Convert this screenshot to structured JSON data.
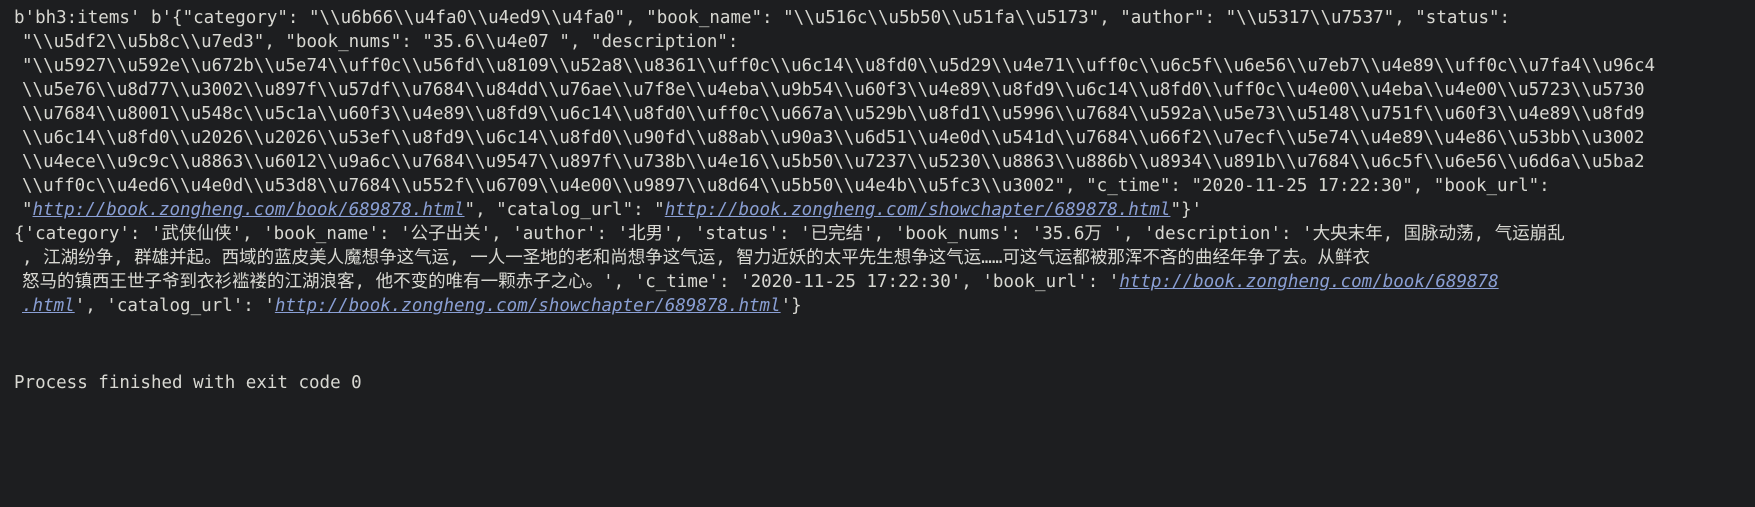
{
  "console": {
    "key_label": "b'bh3:items'",
    "bytes_prefix": "b'",
    "lines": [
      "b'bh3:items' b'{\"category\": \"\\\\u6b66\\\\u4fa0\\\\u4ed9\\\\u4fa0\", \"book_name\": \"\\\\u516c\\\\u5b50\\\\u51fa\\\\u5173\", \"author\": \"\\\\u5317\\\\u7537\", \"status\":",
      "\"\\\\u5df2\\\\u5b8c\\\\u7ed3\", \"book_nums\": \"35.6\\\\u4e07 \", \"description\":",
      "\"\\\\u5927\\\\u592e\\\\u672b\\\\u5e74\\\\uff0c\\\\u56fd\\\\u8109\\\\u52a8\\\\u8361\\\\uff0c\\\\u6c14\\\\u8fd0\\\\u5d29\\\\u4e71\\\\uff0c\\\\u6c5f\\\\u6e56\\\\u7eb7\\\\u4e89\\\\uff0c\\\\u7fa4\\\\u96c4",
      "\\\\u5e76\\\\u8d77\\\\u3002\\\\u897f\\\\u57df\\\\u7684\\\\u84dd\\\\u76ae\\\\u7f8e\\\\u4eba\\\\u9b54\\\\u60f3\\\\u4e89\\\\u8fd9\\\\u6c14\\\\u8fd0\\\\uff0c\\\\u4e00\\\\u4eba\\\\u4e00\\\\u5723\\\\u5730",
      "\\\\u7684\\\\u8001\\\\u548c\\\\u5c1a\\\\u60f3\\\\u4e89\\\\u8fd9\\\\u6c14\\\\u8fd0\\\\uff0c\\\\u667a\\\\u529b\\\\u8fd1\\\\u5996\\\\u7684\\\\u592a\\\\u5e73\\\\u5148\\\\u751f\\\\u60f3\\\\u4e89\\\\u8fd9",
      "\\\\u6c14\\\\u8fd0\\\\u2026\\\\u2026\\\\u53ef\\\\u8fd9\\\\u6c14\\\\u8fd0\\\\u90fd\\\\u88ab\\\\u90a3\\\\u6d51\\\\u4e0d\\\\u541d\\\\u7684\\\\u66f2\\\\u7ecf\\\\u5e74\\\\u4e89\\\\u4e86\\\\u53bb\\\\u3002",
      "\\\\u4ece\\\\u9c9c\\\\u8863\\\\u6012\\\\u9a6c\\\\u7684\\\\u9547\\\\u897f\\\\u738b\\\\u4e16\\\\u5b50\\\\u7237\\\\u5230\\\\u8863\\\\u886b\\\\u8934\\\\u891b\\\\u7684\\\\u6c5f\\\\u6e56\\\\u6d6a\\\\u5ba2",
      "\\\\uff0c\\\\u4ed6\\\\u4e0d\\\\u53d8\\\\u7684\\\\u552f\\\\u6709\\\\u4e00\\\\u9897\\\\u8d64\\\\u5b50\\\\u4e4b\\\\u5fc3\\\\u3002\", \"c_time\": \"2020-11-25 17:22:30\", \"book_url\":"
    ],
    "url_line": {
      "pre": "\"",
      "book_url": "http://book.zongheng.com/book/689878.html",
      "mid": "\", \"catalog_url\": \"",
      "catalog_url": "http://book.zongheng.com/showchapter/689878.html",
      "post": "\"}'"
    },
    "dict_lines": [
      "{'category': '武侠仙侠', 'book_name': '公子出关', 'author': '北男', 'status': '已完结', 'book_nums': '35.6万 ', 'description': '大央末年, 国脉动荡, 气运崩乱",
      ", 江湖纷争, 群雄并起。西域的蓝皮美人魔想争这气运, 一人一圣地的老和尚想争这气运, 智力近妖的太平先生想争这气运……可这气运都被那浑不吝的曲经年争了去。从鲜衣",
      "怒马的镇西王世子爷到衣衫褴褛的江湖浪客, 他不变的唯有一颗赤子之心。', 'c_time': '2020-11-25 17:22:30', 'book_url': '"
    ],
    "dict_url_book": "http://book.zongheng.com/book/689878",
    "dict_tail_pre": ".html",
    "dict_tail_mid": "', 'catalog_url': '",
    "dict_url_catalog": "http://book.zongheng.com/showchapter/689878.html",
    "dict_tail_post": "'}",
    "exit_message": "Process finished with exit code 0",
    "colors": {
      "background": "#1d1e20",
      "text": "#d8d8d2",
      "link": "#8a9fd4"
    }
  }
}
